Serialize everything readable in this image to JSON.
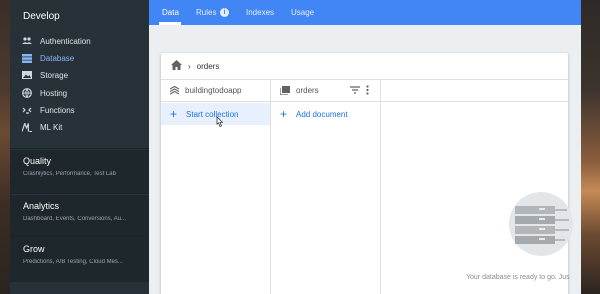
{
  "sidebar": {
    "header": "Develop",
    "items": [
      {
        "label": "Authentication",
        "icon": "people-icon",
        "active": false
      },
      {
        "label": "Database",
        "icon": "database-icon",
        "active": true
      },
      {
        "label": "Storage",
        "icon": "image-icon",
        "active": false
      },
      {
        "label": "Hosting",
        "icon": "globe-icon",
        "active": false
      },
      {
        "label": "Functions",
        "icon": "functions-icon",
        "active": false
      },
      {
        "label": "ML Kit",
        "icon": "ml-kit-icon",
        "active": false
      }
    ],
    "sections": [
      {
        "title": "Quality",
        "sub": "Crashlytics, Performance, Test Lab"
      },
      {
        "title": "Analytics",
        "sub": "Dashboard, Events, Conversions, Au..."
      },
      {
        "title": "Grow",
        "sub": "Predictions, A/B Testing, Cloud Mes..."
      }
    ]
  },
  "tabs": [
    {
      "label": "Data",
      "active": true
    },
    {
      "label": "Rules",
      "active": false
    },
    {
      "label": "Indexes",
      "active": false
    },
    {
      "label": "Usage",
      "active": false
    }
  ],
  "breadcrumb": {
    "path": "orders"
  },
  "columns": {
    "root": {
      "title": "buildingtodoapp",
      "action": "Start collection"
    },
    "collection": {
      "title": "orders",
      "action": "Add document"
    }
  },
  "empty_state": {
    "text": "Your database is ready to go. Jus"
  },
  "colors": {
    "sidebar": "#263238",
    "tabbar": "#4285f4",
    "accent": "#1a73e8",
    "active_nav": "#8ab4f8"
  }
}
